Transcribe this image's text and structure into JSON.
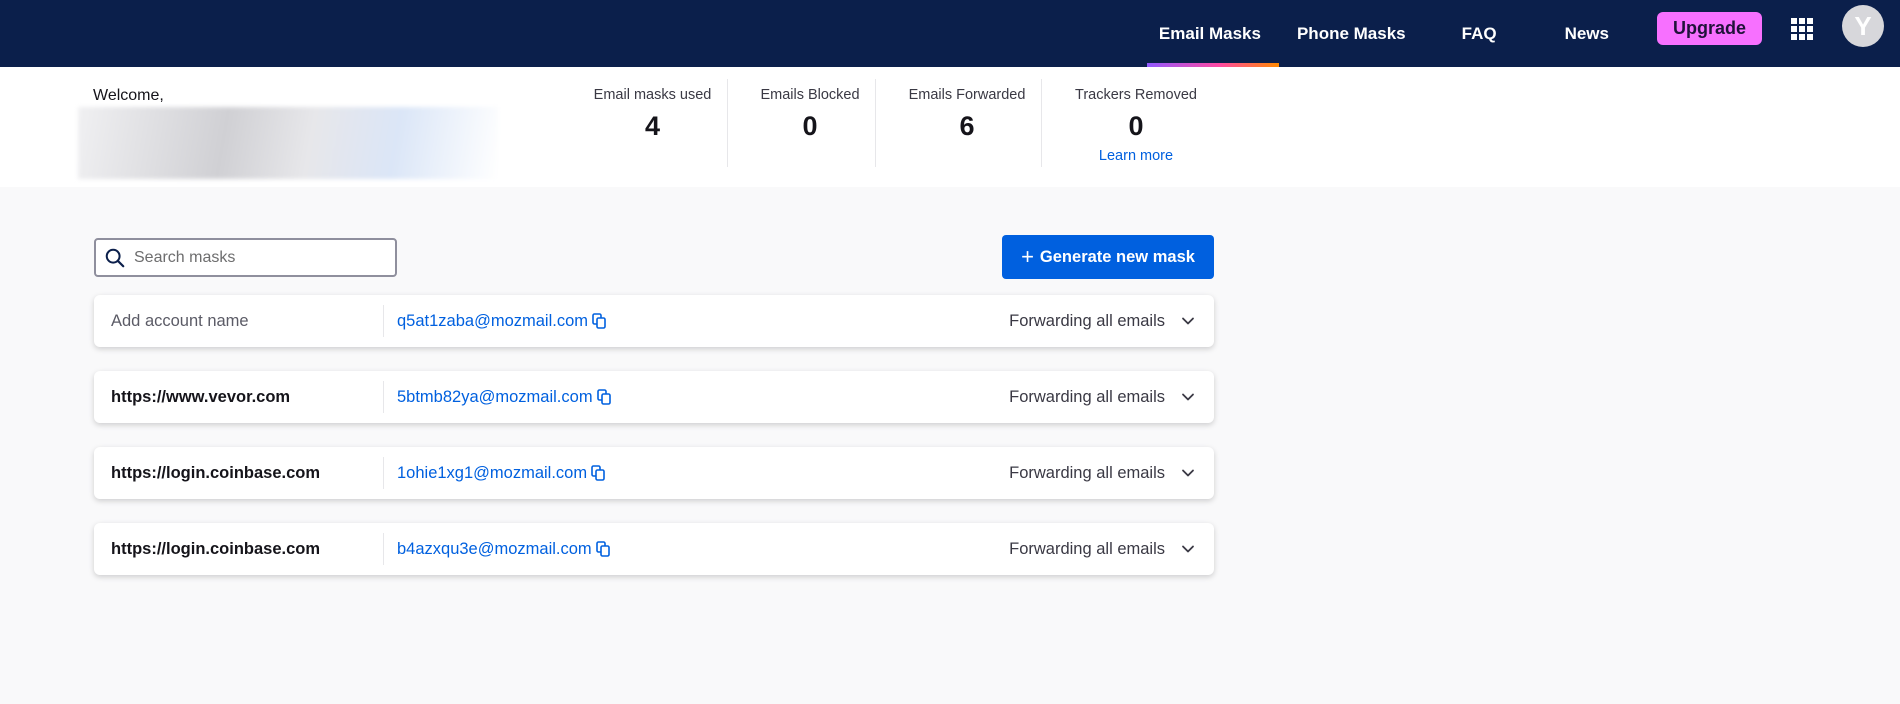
{
  "nav": {
    "links": [
      {
        "label": "Email Masks",
        "active": true
      },
      {
        "label": "Phone Masks",
        "active": false
      },
      {
        "label": "FAQ",
        "active": false
      },
      {
        "label": "News",
        "active": false
      }
    ],
    "upgrade_label": "Upgrade",
    "avatar_initial": "Y",
    "bar_color": "#0b1f4b",
    "upgrade_color": "#f770ff"
  },
  "header": {
    "welcome": "Welcome,"
  },
  "stats": [
    {
      "label": "Email masks used",
      "value": "4"
    },
    {
      "label": "Emails Blocked",
      "value": "0"
    },
    {
      "label": "Emails Forwarded",
      "value": "6"
    },
    {
      "label": "Trackers Removed",
      "value": "0",
      "link": "Learn more"
    }
  ],
  "toolbar": {
    "search_placeholder": "Search masks",
    "generate_label": "Generate new mask",
    "accent": "#0060df"
  },
  "masks": [
    {
      "name": "Add account name",
      "placeholder": true,
      "address": "q5at1zaba@mozmail.com",
      "status": "Forwarding all emails"
    },
    {
      "name": "https://www.vevor.com",
      "placeholder": false,
      "address": "5btmb82ya@mozmail.com",
      "status": "Forwarding all emails"
    },
    {
      "name": "https://login.coinbase.com",
      "placeholder": false,
      "address": "1ohie1xg1@mozmail.com",
      "status": "Forwarding all emails"
    },
    {
      "name": "https://login.coinbase.com",
      "placeholder": false,
      "address": "b4azxqu3e@mozmail.com",
      "status": "Forwarding all emails"
    }
  ]
}
